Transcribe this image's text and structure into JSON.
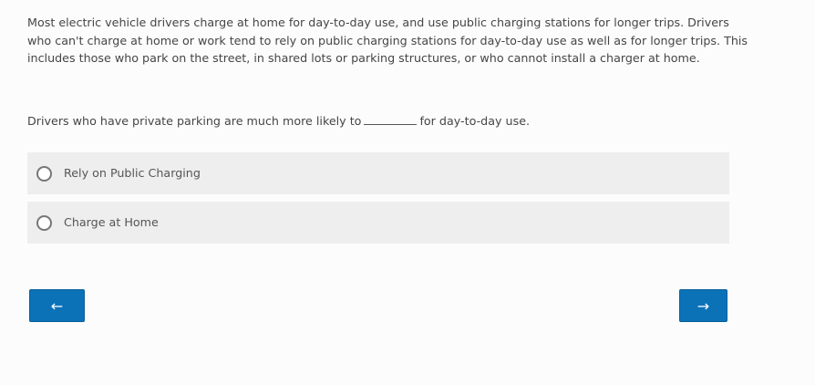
{
  "passage": {
    "text": "Most electric vehicle drivers charge at home for day-to-day use, and use public charging stations for longer trips. Drivers who can't charge at home or work tend to rely on public charging stations for day-to-day use as well as for longer trips. This includes those who park on the street, in shared lots or parking structures, or who cannot install a charger at home."
  },
  "question": {
    "before_blank": "Drivers who have private parking are much more likely to",
    "after_blank": "for day-to-day use."
  },
  "options": [
    {
      "label": "Rely on Public Charging",
      "selected": false
    },
    {
      "label": "Charge at Home",
      "selected": false
    }
  ],
  "navigation": {
    "back_label": "←",
    "next_label": "→"
  },
  "colors": {
    "button": "#0c72b8",
    "option_background": "#eeeeee",
    "text": "#454545"
  }
}
